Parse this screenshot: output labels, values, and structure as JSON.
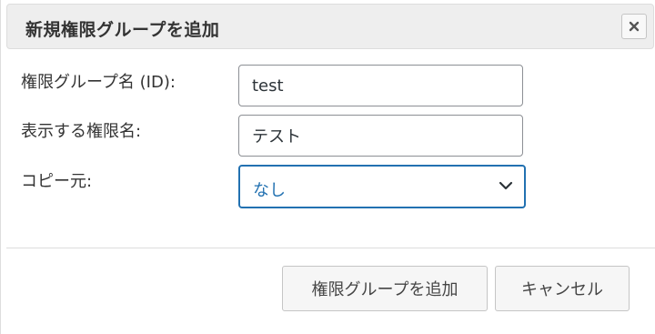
{
  "dialog": {
    "title": "新規権限グループを追加"
  },
  "form": {
    "group_id": {
      "label": "権限グループ名 (ID):",
      "value": "test"
    },
    "display_name": {
      "label": "表示する権限名:",
      "value": "テスト"
    },
    "copy_from": {
      "label": "コピー元:",
      "selected": "なし"
    }
  },
  "buttons": {
    "add": "権限グループを追加",
    "cancel": "キャンセル"
  },
  "icons": {
    "close": "close-icon",
    "dropdown": "chevron-down-icon"
  },
  "colors": {
    "accent": "#2271b1",
    "titlebar_bg": "#eeeeee",
    "button_bg": "#f6f6f6"
  }
}
